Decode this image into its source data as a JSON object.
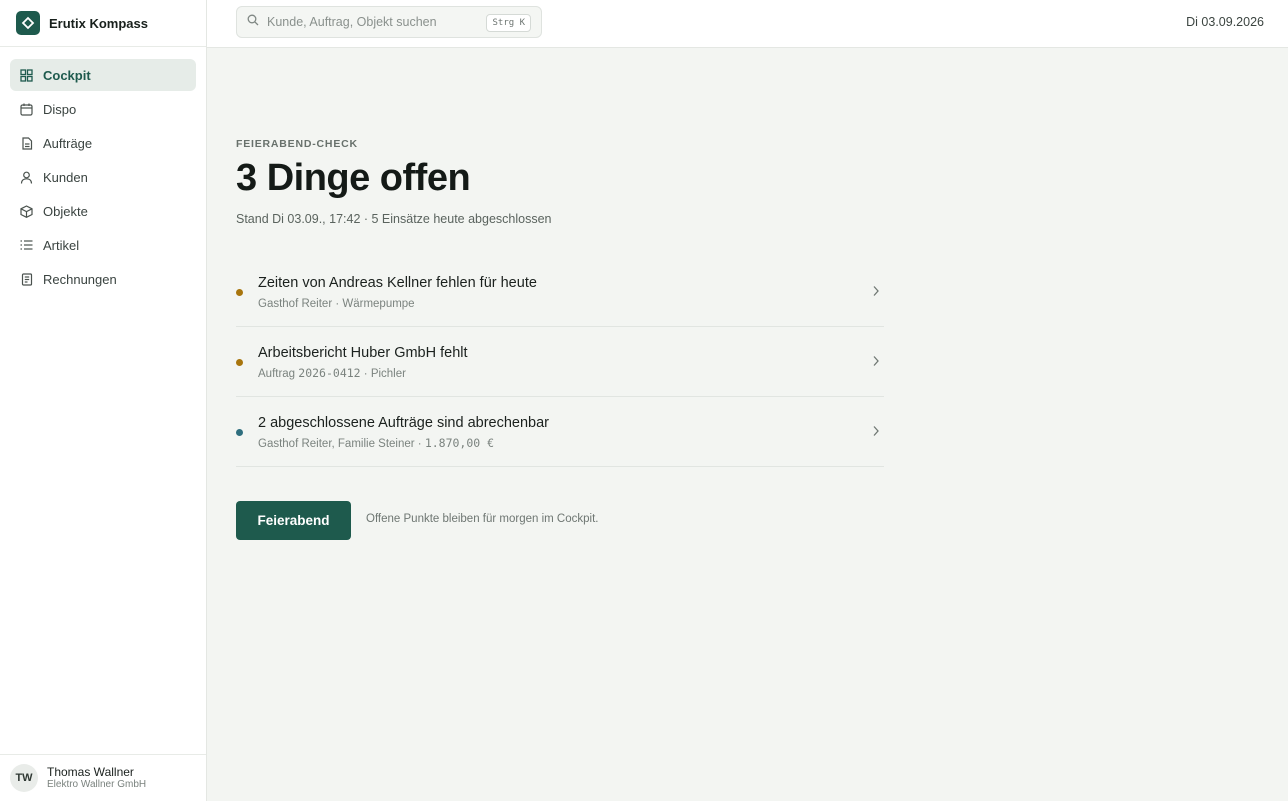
{
  "app": {
    "name": "Erutix Kompass"
  },
  "sidebar": {
    "items": [
      {
        "label": "Cockpit",
        "icon": "grid-icon",
        "active": true
      },
      {
        "label": "Dispo",
        "icon": "calendar-icon"
      },
      {
        "label": "Aufträge",
        "icon": "document-icon"
      },
      {
        "label": "Kunden",
        "icon": "user-icon"
      },
      {
        "label": "Objekte",
        "icon": "cube-icon"
      },
      {
        "label": "Artikel",
        "icon": "list-icon"
      },
      {
        "label": "Rechnungen",
        "icon": "receipt-icon"
      }
    ]
  },
  "user": {
    "initials": "TW",
    "name": "Thomas Wallner",
    "org": "Elektro Wallner GmbH"
  },
  "topbar": {
    "search_placeholder": "Kunde, Auftrag, Objekt suchen",
    "shortcut": "Strg K",
    "date": "Di 03.09.2026"
  },
  "main": {
    "eyebrow": "FEIERABEND-CHECK",
    "headline": "3 Dinge offen",
    "stand": "Stand Di 03.09., 17:42 · 5 Einsätze heute abgeschlossen",
    "tasks": [
      {
        "title": "Zeiten von Andreas Kellner fehlen für heute",
        "sub_text": "Gasthof Reiter · Wärmepumpe",
        "sub_mono": "",
        "sub_tail": "",
        "dot_color": "#a8750d"
      },
      {
        "title": "Arbeitsbericht Huber GmbH fehlt",
        "sub_text": "Auftrag ",
        "sub_mono": "2026-0412",
        "sub_tail": " · Pichler",
        "dot_color": "#a8750d"
      },
      {
        "title": "2 abgeschlossene Aufträge sind abrechenbar",
        "sub_text": "Gasthof Reiter, Familie Steiner · ",
        "sub_mono": "1.870,00 €",
        "sub_tail": "",
        "dot_color": "#2e6e7e"
      }
    ],
    "cta_label": "Feierabend",
    "cta_note": "Offene Punkte bleiben für morgen im Cockpit."
  },
  "colors": {
    "accent": "#1e5a4d",
    "warning_dot": "#a8750d",
    "info_dot": "#2e6e7e"
  }
}
